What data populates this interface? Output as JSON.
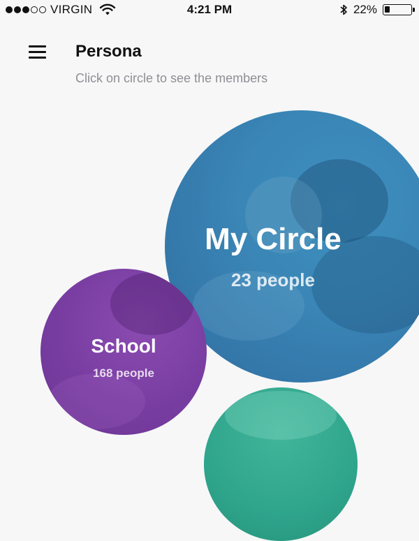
{
  "status_bar": {
    "carrier": "VIRGIN",
    "time": "4:21 PM",
    "battery": "22%",
    "battery_level": 0.22,
    "signal_bars_filled": 3,
    "signal_bars_total": 5
  },
  "header": {
    "title": "Persona",
    "subtitle": "Click on circle to see the members"
  },
  "circles": [
    {
      "name": "My Circle",
      "count": "23 people",
      "color": "#3a86b6"
    },
    {
      "name": "School",
      "count": "168 people",
      "color": "#7a3ea3"
    },
    {
      "name": "",
      "count": "",
      "color": "#2fa58c"
    }
  ]
}
